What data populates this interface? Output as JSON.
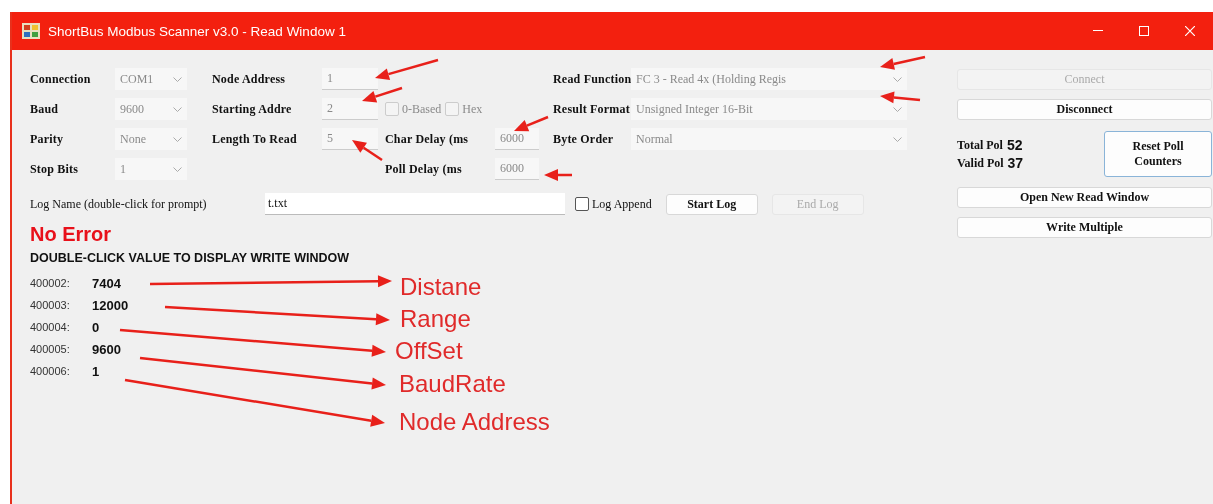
{
  "window": {
    "title": "ShortBus Modbus Scanner v3.0 - Read Window 1"
  },
  "serial": [
    {
      "kind": "combo",
      "label": "Connection",
      "value": "COM1",
      "disabled": true
    },
    {
      "kind": "combo",
      "label": "Baud",
      "value": "9600",
      "disabled": true
    },
    {
      "kind": "combo",
      "label": "Parity",
      "value": "None",
      "disabled": true
    },
    {
      "kind": "combo",
      "label": "Stop Bits",
      "value": "1",
      "disabled": true
    }
  ],
  "addressing": [
    {
      "kind": "field",
      "label": "Node Address",
      "value": "1",
      "disabled": true
    },
    {
      "kind": "field",
      "label": "Starting Addre",
      "value": "2",
      "disabled": true
    },
    {
      "kind": "field",
      "label": "Length To Read",
      "value": "5",
      "disabled": true
    }
  ],
  "options": [
    {
      "label": "0-Based",
      "checked": false,
      "disabled": true
    },
    {
      "label": "Hex",
      "checked": false,
      "disabled": true
    }
  ],
  "delays": [
    {
      "kind": "field",
      "label": "Char Delay (ms",
      "value": "6000",
      "disabled": true
    },
    {
      "kind": "field",
      "label": "Poll Delay (ms",
      "value": "6000",
      "disabled": true
    }
  ],
  "read": [
    {
      "kind": "combo",
      "label": "Read Function",
      "value": "FC 3 - Read 4x (Holding Regis",
      "disabled": true
    },
    {
      "kind": "combo",
      "label": "Result Format",
      "value": "Unsigned Integer 16-Bit",
      "disabled": true
    },
    {
      "kind": "combo",
      "label": "Byte Order",
      "value": "Normal",
      "disabled": true
    }
  ],
  "log": {
    "label": "Log Name (double-click for prompt)",
    "value": "t.txt",
    "append": {
      "label": "Log Append",
      "checked": false
    },
    "buttons": [
      {
        "label": "Start Log",
        "disabled": false
      },
      {
        "label": "End Log",
        "disabled": true
      }
    ]
  },
  "connect_buttons": [
    {
      "label": "Connect",
      "disabled": true
    },
    {
      "label": "Disconnect",
      "disabled": false
    }
  ],
  "counters": [
    {
      "label": "Total Pol",
      "value": "52"
    },
    {
      "label": "Valid Pol",
      "value": "37"
    }
  ],
  "reset_button": {
    "label": "Reset Poll Counters"
  },
  "window_buttons": [
    {
      "label": "Open New Read Window"
    },
    {
      "label": "Write Multiple"
    }
  ],
  "status": "No Error",
  "hint": "DOUBLE-CLICK VALUE TO DISPLAY WRITE WINDOW",
  "registers": [
    {
      "address": "400002:",
      "value": "7404"
    },
    {
      "address": "400003:",
      "value": "12000"
    },
    {
      "address": "400004:",
      "value": "0"
    },
    {
      "address": "400005:",
      "value": "9600"
    },
    {
      "address": "400006:",
      "value": "1"
    }
  ],
  "annotations": [
    "Distane",
    "Range",
    "OffSet",
    "BaudRate",
    "Node Address"
  ]
}
